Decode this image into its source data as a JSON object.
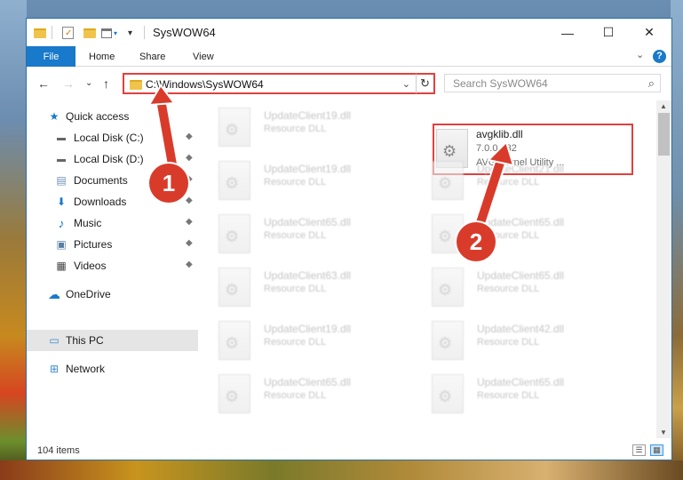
{
  "window": {
    "title": "SysWOW64"
  },
  "window_controls": {
    "minimize": "—",
    "maximize": "☐",
    "close": "✕"
  },
  "ribbon": {
    "tabs": [
      "File",
      "Home",
      "Share",
      "View"
    ],
    "help": "?",
    "expand": "⌄"
  },
  "nav": {
    "back": "←",
    "forward": "→",
    "recent": "⌄",
    "up": "↑",
    "address": "C:\\Windows\\SysWOW64",
    "address_dropdown": "⌄",
    "refresh": "↻",
    "search_placeholder": "Search SysWOW64",
    "search_icon": "⌕"
  },
  "sidebar": {
    "items": [
      {
        "label": "Quick access",
        "icon": "star-icon",
        "glyph": "★",
        "pinned": false
      },
      {
        "label": "Local Disk (C:)",
        "icon": "drive-icon",
        "glyph": "▬",
        "pinned": true
      },
      {
        "label": "Local Disk (D:)",
        "icon": "drive-icon",
        "glyph": "▬",
        "pinned": true
      },
      {
        "label": "Documents",
        "icon": "documents-icon",
        "glyph": "▤",
        "pinned": true
      },
      {
        "label": "Downloads",
        "icon": "downloads-icon",
        "glyph": "⬇",
        "pinned": true
      },
      {
        "label": "Music",
        "icon": "music-icon",
        "glyph": "♪",
        "pinned": true
      },
      {
        "label": "Pictures",
        "icon": "pictures-icon",
        "glyph": "▣",
        "pinned": true
      },
      {
        "label": "Videos",
        "icon": "videos-icon",
        "glyph": "▦",
        "pinned": true
      },
      {
        "label": "OneDrive",
        "icon": "cloud-icon",
        "glyph": "☁",
        "pinned": false
      },
      {
        "label": "This PC",
        "icon": "computer-icon",
        "glyph": "▭",
        "pinned": false
      },
      {
        "label": "Network",
        "icon": "network-icon",
        "glyph": "⊞",
        "pinned": false
      }
    ],
    "pin_glyph": "📌"
  },
  "files": {
    "highlighted": {
      "name": "avgklib.dll",
      "version": "7.0.0.132",
      "description": "AVG Kernel Utility ..."
    },
    "blurred": [
      {
        "name": "UpdateClient19.dll",
        "desc": "Resource DLL"
      },
      {
        "name": "UpdateClient19.dll",
        "desc": "Resource DLL"
      },
      {
        "name": "UpdateClient21.dll",
        "desc": "Resource DLL"
      },
      {
        "name": "UpdateClient65.dll",
        "desc": "Resource DLL"
      },
      {
        "name": "UpdateClient65.dll",
        "desc": "Resource DLL"
      },
      {
        "name": "UpdateClient63.dll",
        "desc": "Resource DLL"
      },
      {
        "name": "UpdateClient65.dll",
        "desc": "Resource DLL"
      },
      {
        "name": "UpdateClient19.dll",
        "desc": "Resource DLL"
      },
      {
        "name": "UpdateClient42.dll",
        "desc": "Resource DLL"
      },
      {
        "name": "UpdateClient65.dll",
        "desc": "Resource DLL"
      },
      {
        "name": "UpdateClient65.dll",
        "desc": "Resource DLL"
      }
    ]
  },
  "status": {
    "item_count": "104 items"
  },
  "annotations": {
    "step1": "1",
    "step2": "2",
    "color": "#d93b2b"
  }
}
